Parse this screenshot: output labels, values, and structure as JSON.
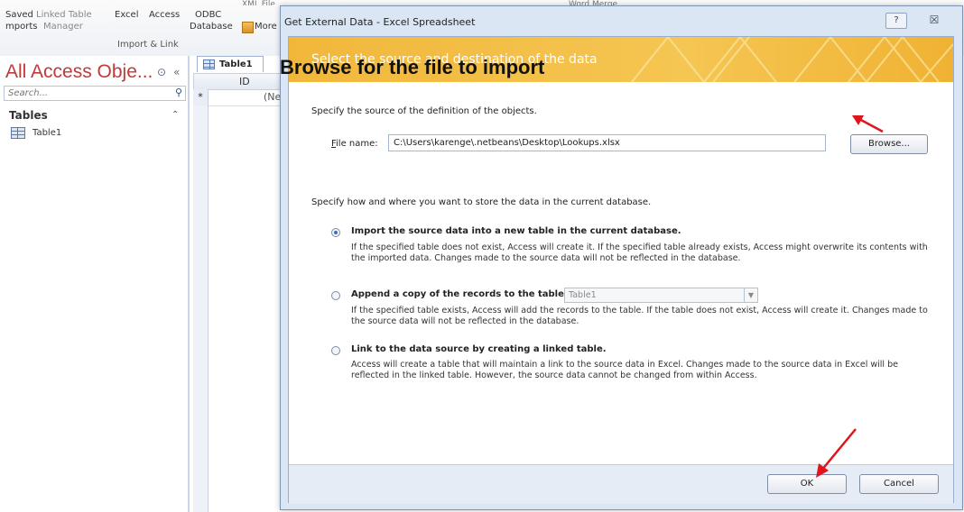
{
  "ribbon": {
    "top_stub_1": "XML File",
    "top_stub_2": "Word Merge",
    "saved_imports_1": "Saved",
    "saved_imports_2": "mports",
    "linked_table_1": "Linked Table",
    "linked_table_2": "Manager",
    "excel": "Excel",
    "access": "Access",
    "odbc_1": "ODBC",
    "odbc_2": "Database",
    "more": "More",
    "group_label": "Import & Link"
  },
  "nav": {
    "title": "All Access Obje...",
    "search_placeholder": "Search...",
    "category": "Tables",
    "items": [
      {
        "label": "Table1"
      }
    ]
  },
  "document": {
    "tab_label": "Table1",
    "column_header": "ID",
    "new_row_marker": "*",
    "new_row_value": "(Ne"
  },
  "dialog": {
    "title": "Get External Data - Excel Spreadsheet",
    "help": "?",
    "close": "☒",
    "banner": "Select the source and destination of the data",
    "source_instruction": "Specify the source of the definition of the objects.",
    "file_label_ul": "F",
    "file_label_rest": "ile name:",
    "file_value": "C:\\Users\\karenge\\.netbeans\\Desktop\\Lookups.xlsx",
    "browse_label": "Browse...",
    "storage_instruction": "Specify how and where you want to store the data in the current database.",
    "options": [
      {
        "title": "Import the source data into a new table in the current database.",
        "description": "If the specified table does not exist, Access will create it. If the specified table already exists, Access might overwrite its contents with the imported data. Changes made to the source data will not be reflected in the database.",
        "checked": true
      },
      {
        "title": "Append a copy of the records to the table:",
        "description": "If the specified table exists, Access will add the records to the table. If the table does not exist, Access will create it. Changes made to the source data will not be reflected in the database.",
        "checked": false,
        "combo_value": "Table1"
      },
      {
        "title": "Link to the data source by creating a linked table.",
        "description": "Access will create a table that will maintain a link to the source data in Excel. Changes made to the source data in Excel will be reflected in the linked table. However, the source data cannot be changed from within Access.",
        "checked": false
      }
    ],
    "ok_label": "OK",
    "cancel_label": "Cancel"
  },
  "annotation": {
    "text": "Browse for the file to import",
    "arrow_color": "#e0141c"
  },
  "colors": {
    "banner": "#f1b73b",
    "nav_title": "#c2393a",
    "radio_selected": "#3a6fc0"
  }
}
